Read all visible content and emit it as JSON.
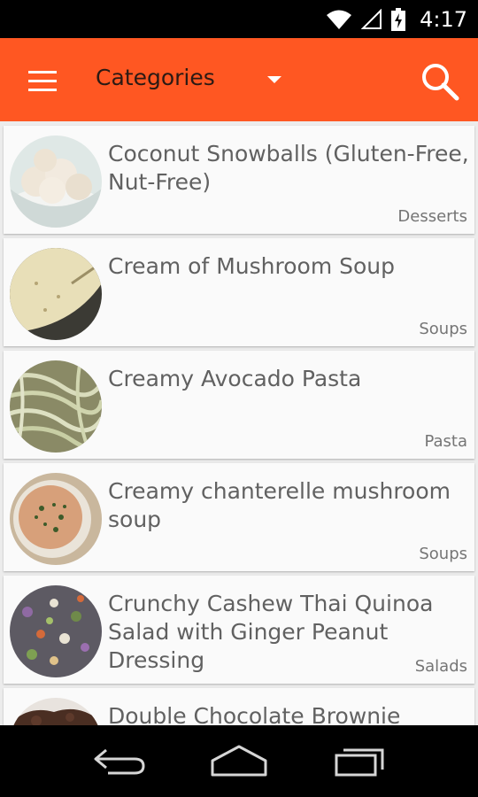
{
  "status_bar": {
    "time": "4:17",
    "icons": [
      "wifi-icon",
      "signal-icon",
      "battery-charging-icon"
    ]
  },
  "app_bar": {
    "title": "Categories",
    "menu_icon": "menu-icon",
    "search_icon": "search-icon",
    "accent_color": "#ff5722"
  },
  "recipes": [
    {
      "title": "Coconut Snowballs (Gluten-Free, Nut-Free)",
      "category": "Desserts"
    },
    {
      "title": "Cream of Mushroom Soup",
      "category": "Soups"
    },
    {
      "title": "Creamy Avocado Pasta",
      "category": "Pasta"
    },
    {
      "title": "Creamy chanterelle mushroom soup",
      "category": "Soups"
    },
    {
      "title": "Crunchy Cashew Thai Quinoa Salad with Ginger Peanut Dressing",
      "category": "Salads"
    },
    {
      "title": "Double Chocolate Brownie",
      "category": ""
    }
  ],
  "nav_bar": {
    "icons": [
      "back-icon",
      "home-icon",
      "recent-apps-icon"
    ]
  }
}
